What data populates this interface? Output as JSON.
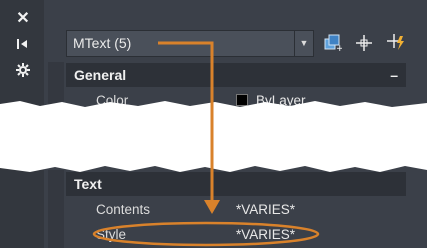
{
  "sidebar": {
    "close_icon": "close-icon",
    "autohide_icon": "autohide-icon",
    "settings_icon": "settings-icon"
  },
  "header": {
    "selection_label": "MText (5)"
  },
  "toolbar": {
    "icons": [
      "toggle-pickadd-icon",
      "select-objects-icon",
      "quick-select-icon"
    ]
  },
  "sections": {
    "general": {
      "title": "General",
      "toggle": "–",
      "rows": [
        {
          "label": "Color",
          "value": "ByLayer"
        }
      ]
    },
    "text": {
      "title": "Text",
      "rows": [
        {
          "label": "Contents",
          "value": "*VARIES*"
        },
        {
          "label": "Style",
          "value": "*VARIES*"
        }
      ]
    }
  },
  "colors": {
    "annotation": "#d9822b",
    "panel": "#3b4049",
    "header": "#2d3138"
  }
}
